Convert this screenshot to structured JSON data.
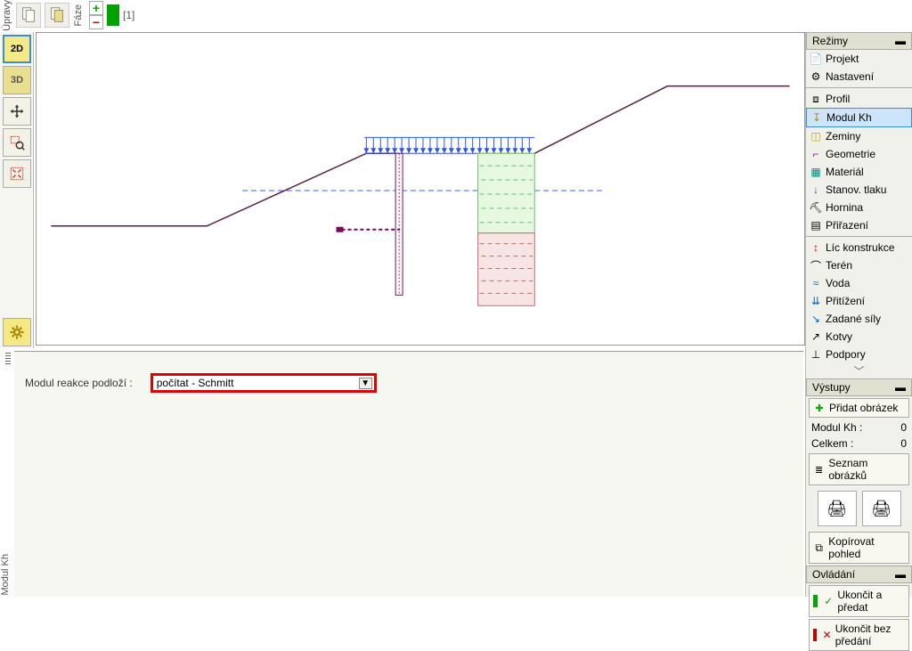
{
  "topbar": {
    "edits_label": "Úpravy",
    "phase_label": "Fáze",
    "stage_number": "[1]"
  },
  "left_tools": {
    "btn2d": "2D",
    "btn3d": "3D"
  },
  "right": {
    "modes_header": "Režimy",
    "items": [
      "Projekt",
      "Nastavení",
      "Profil",
      "Modul Kh",
      "Zeminy",
      "Geometrie",
      "Materiál",
      "Stanov. tlaku",
      "Hornina",
      "Přiřazení",
      "Líc konstrukce",
      "Terén",
      "Voda",
      "Přitížení",
      "Zadané síly",
      "Kotvy",
      "Podpory"
    ],
    "outputs_header": "Výstupy",
    "add_image": "Přidat obrázek",
    "modul_kh_label": "Modul Kh :",
    "modul_kh_value": "0",
    "total_label": "Celkem :",
    "total_value": "0",
    "images_list": "Seznam obrázků",
    "copy_view": "Kopírovat pohled",
    "control_header": "Ovládání",
    "end_pass": "Ukončit a předat",
    "end_nopass": "Ukončit bez předání"
  },
  "bottom": {
    "param_label": "Modul reakce podloží :",
    "select_value": "počítat - Schmitt"
  },
  "left_tab": "Modul Kh"
}
